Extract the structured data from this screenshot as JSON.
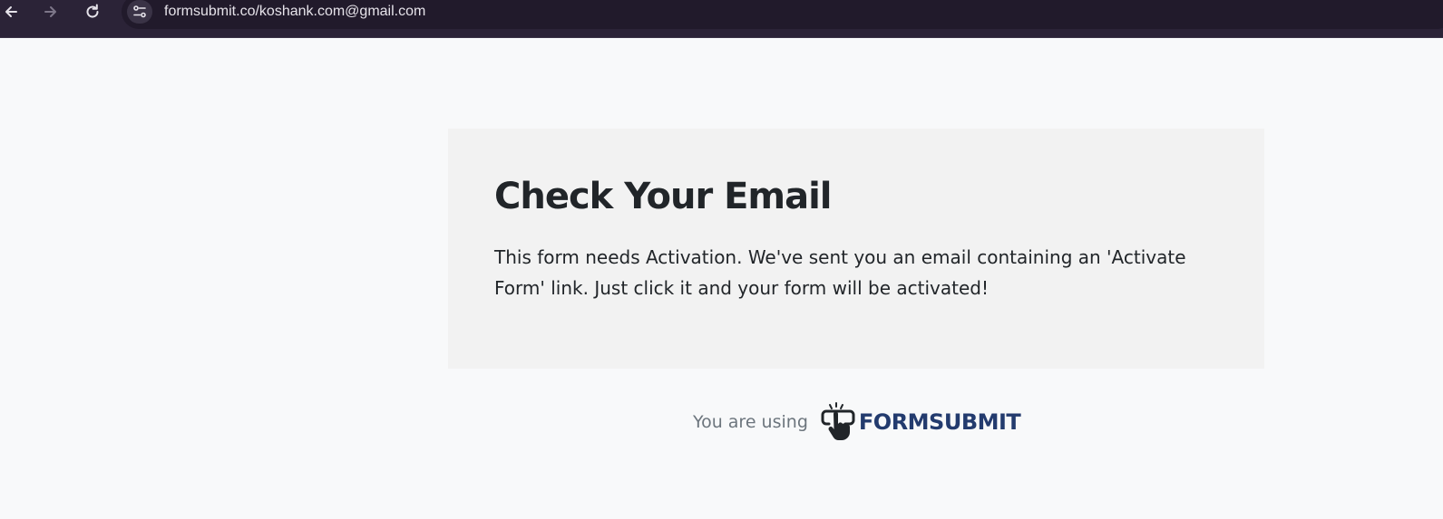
{
  "browser": {
    "url": "formsubmit.co/koshank.com@gmail.com",
    "icons": {
      "back": "arrow-left-icon",
      "forward": "arrow-right-icon",
      "reload": "reload-icon",
      "site_info": "tune-icon"
    }
  },
  "card": {
    "title": "Check Your Email",
    "message": "This form needs Activation. We've sent you an email containing an 'Activate Form' link. Just click it and your form will be activated!"
  },
  "footer": {
    "prefix": "You are using",
    "brand": "FORMSUBMIT"
  },
  "colors": {
    "toolbar": "#2b2337",
    "page_bg": "#f8f9fa",
    "card_bg": "#f2f2f2",
    "brand": "#233b6e",
    "heading": "#212529",
    "muted": "#6c757d"
  }
}
